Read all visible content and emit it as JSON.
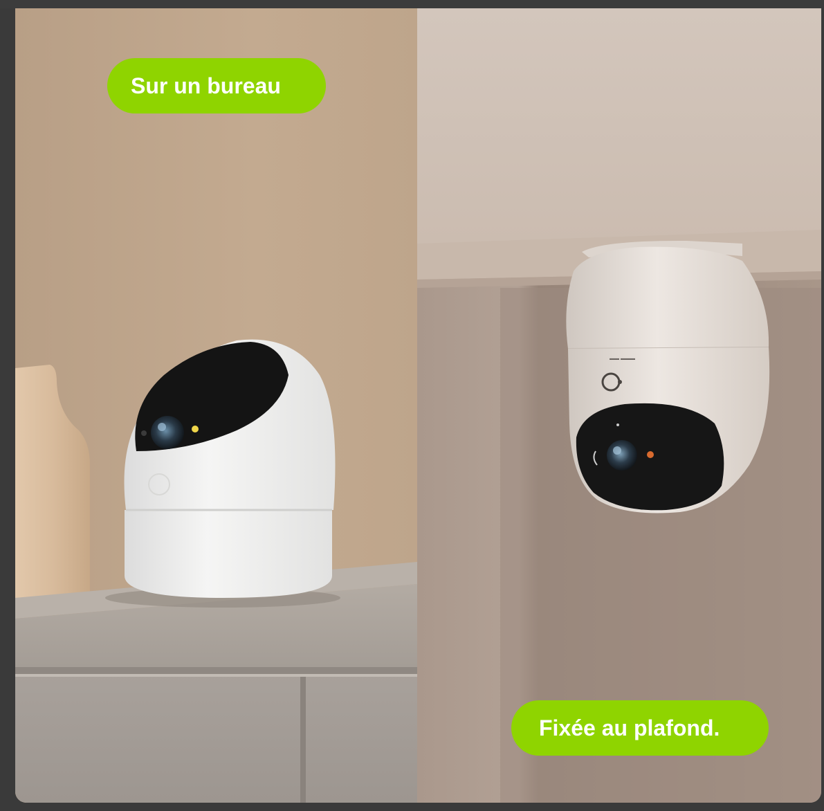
{
  "labels": {
    "desk": "Sur un bureau",
    "ceiling": "Fixée au plafond."
  },
  "colors": {
    "accent_green": "#8fd400",
    "label_text": "#ffffff",
    "frame_dark": "#3a3a3a"
  },
  "scenes": {
    "left": "camera-on-desk-photo",
    "right": "camera-mounted-on-ceiling-photo"
  }
}
